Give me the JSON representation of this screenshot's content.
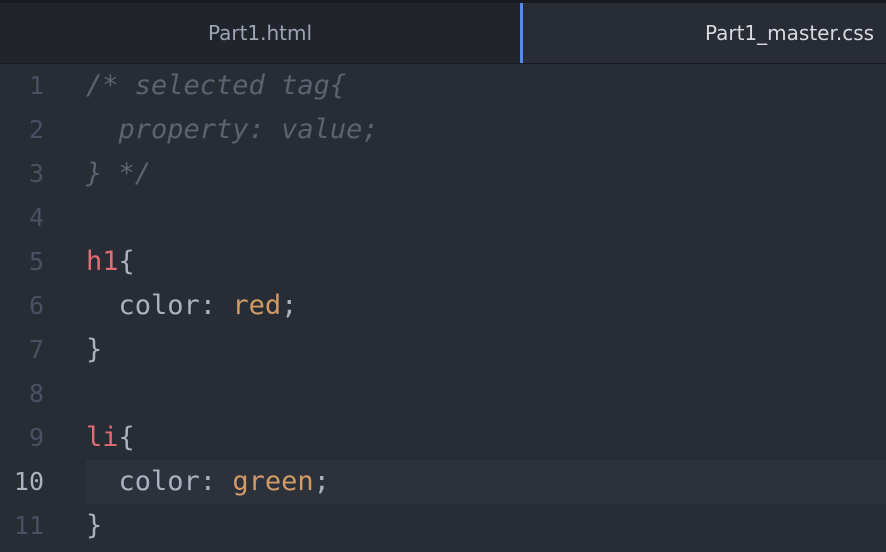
{
  "tabs": [
    {
      "label": "Part1.html",
      "active": false
    },
    {
      "label": "Part1_master.css",
      "active": true
    }
  ],
  "editor": {
    "language": "css",
    "cursor_line": 10,
    "lines": [
      {
        "num": "1",
        "text": "/* selected tag{"
      },
      {
        "num": "2",
        "text": "  property: value;"
      },
      {
        "num": "3",
        "text": "} */"
      },
      {
        "num": "4",
        "text": ""
      },
      {
        "num": "5",
        "selector": "h1",
        "brace": "{"
      },
      {
        "num": "6",
        "indent": "  ",
        "property": "color",
        "colon": ": ",
        "value": "red",
        "semi": ";"
      },
      {
        "num": "7",
        "text": "}"
      },
      {
        "num": "8",
        "text": ""
      },
      {
        "num": "9",
        "selector": "li",
        "brace": "{"
      },
      {
        "num": "10",
        "indent": "  ",
        "property": "color",
        "colon": ": ",
        "value": "green",
        "semi": ";"
      },
      {
        "num": "11",
        "text": "}"
      }
    ]
  },
  "colors": {
    "background": "#282c34",
    "tab_bar": "#21252b",
    "active_tab_accent": "#568af2",
    "comment": "#5c6370",
    "selector": "#e06c75",
    "value": "#d19a66",
    "text": "#abb2bf"
  }
}
